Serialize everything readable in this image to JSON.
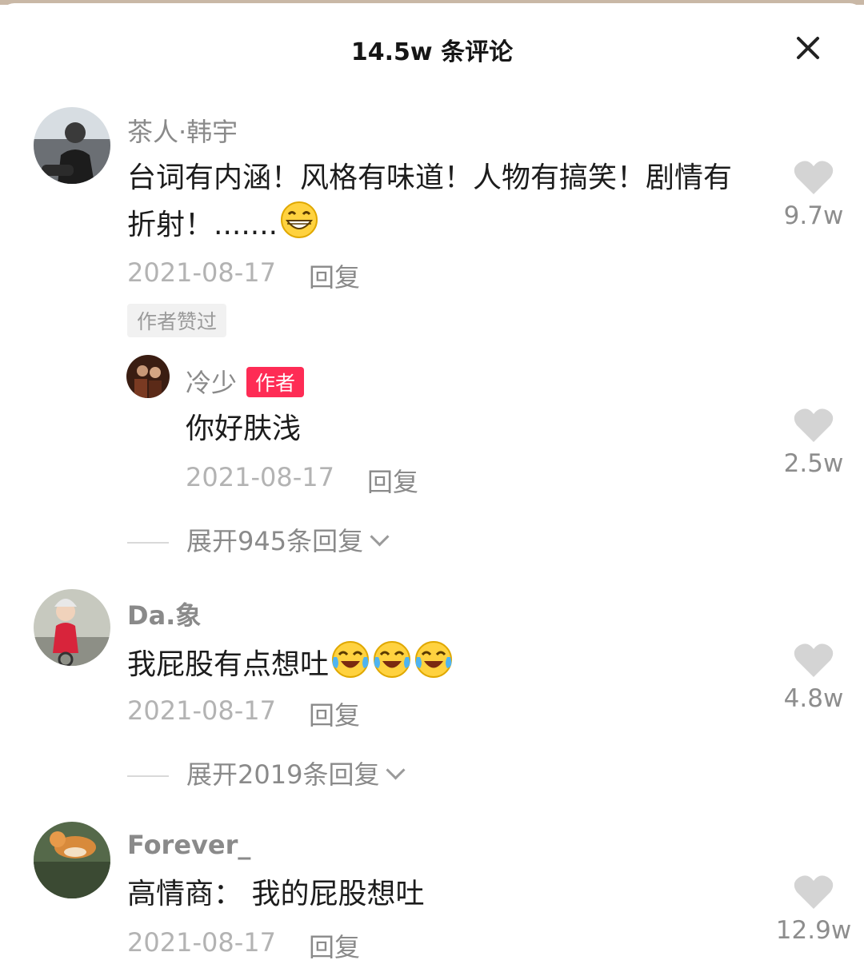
{
  "header": {
    "title": "14.5w 条评论"
  },
  "comments": [
    {
      "name": "茶人·韩宇",
      "text": "台词有内涵！风格有味道！人物有搞笑！剧情有折射！.......",
      "emoji": "grinning-face",
      "date": "2021-08-17",
      "reply_label": "回复",
      "liked_badge": "作者赞过",
      "likes": "9.7w",
      "reply": {
        "name": "冷少",
        "author_badge": "作者",
        "text": "你好肤浅",
        "date": "2021-08-17",
        "reply_label": "回复",
        "likes": "2.5w"
      },
      "expand": "展开945条回复"
    },
    {
      "name": "Da.象",
      "text": "我屁股有点想吐",
      "emoji": "tears-of-joy x3",
      "date": "2021-08-17",
      "reply_label": "回复",
      "likes": "4.8w",
      "expand": "展开2019条回复"
    },
    {
      "name": "Forever_",
      "text": "高情商： 我的屁股想吐",
      "date": "2021-08-17",
      "reply_label": "回复",
      "likes": "12.9w"
    }
  ],
  "colors": {
    "author_badge": "#fe2c55",
    "like_heart": "#d4d4d4"
  }
}
